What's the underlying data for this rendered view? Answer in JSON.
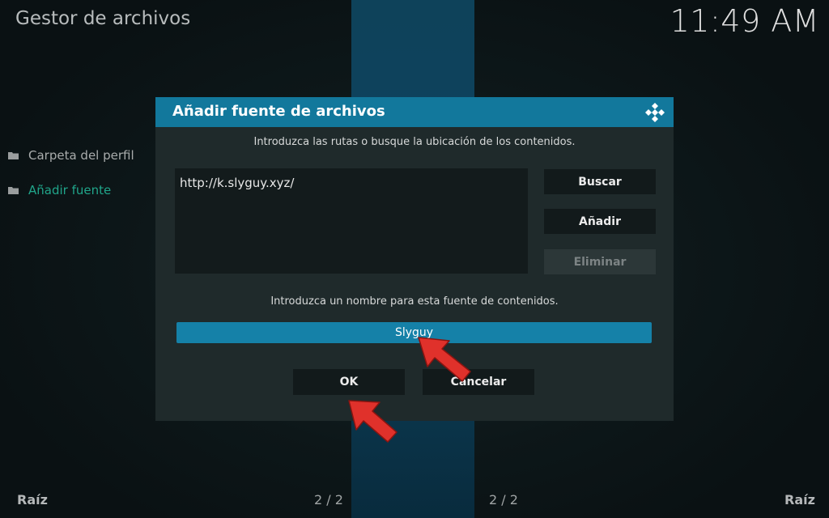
{
  "header": {
    "title": "Gestor de archivos",
    "clock": "11:49 AM"
  },
  "sidebar": {
    "items": [
      {
        "label": "Carpeta del perfil",
        "icon": "folder-icon"
      },
      {
        "label": "Añadir fuente",
        "icon": "folder-icon",
        "active": true
      }
    ]
  },
  "footer": {
    "left_label": "Raíz",
    "left_page": "2 / 2",
    "right_page": "2 / 2",
    "right_label": "Raíz"
  },
  "dialog": {
    "title": "Añadir fuente de archivos",
    "logo_icon": "kodi-logo-icon",
    "paths_hint": "Introduzca las rutas o busque la ubicación de los contenidos.",
    "paths": [
      "http://k.slyguy.xyz/"
    ],
    "buttons": {
      "browse": "Buscar",
      "add": "Añadir",
      "remove": "Eliminar"
    },
    "name_hint": "Introduzca un nombre para esta fuente de contenidos.",
    "name_value": "Slyguy",
    "ok": "OK",
    "cancel": "Cancelar"
  },
  "colors": {
    "accent": "#12789c",
    "active_text": "#20a58a",
    "annotation_arrow": "#e0312b"
  }
}
